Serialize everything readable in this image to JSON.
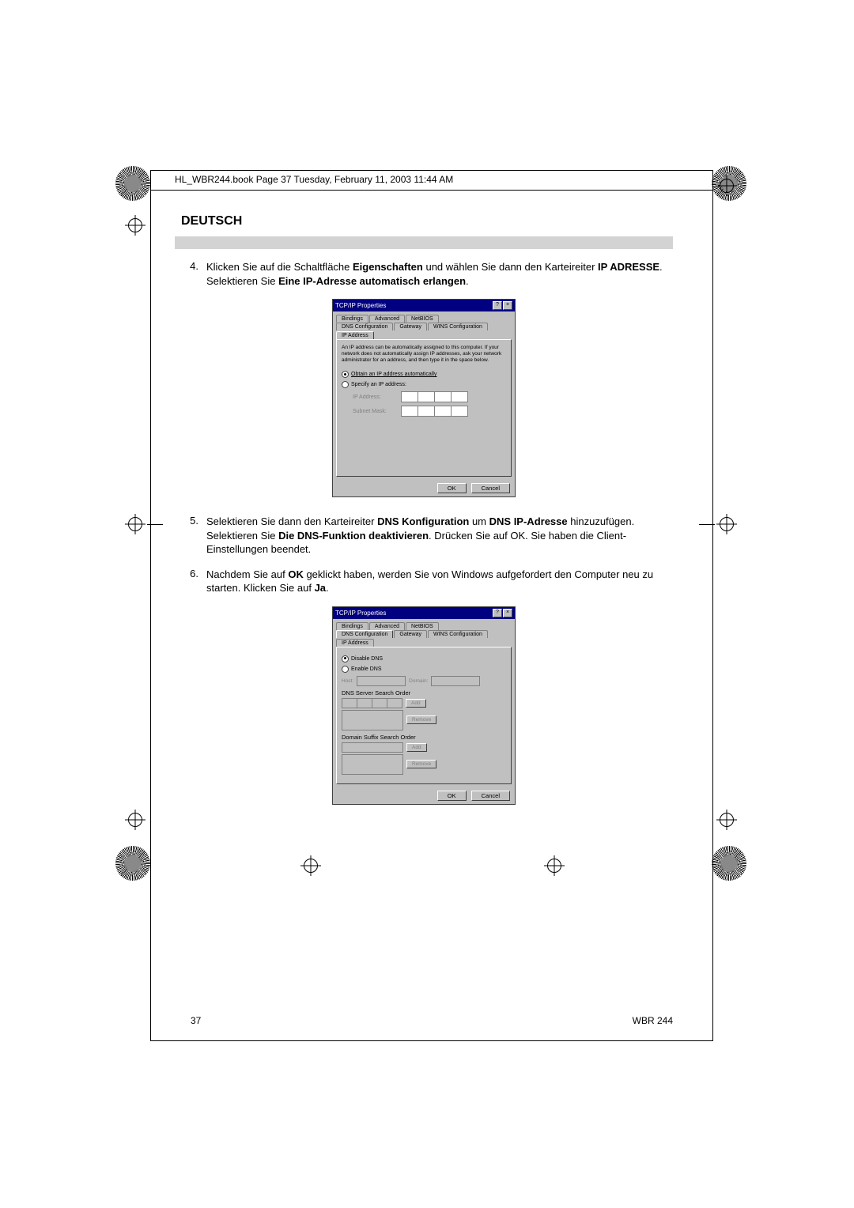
{
  "header_line": "HL_WBR244.book  Page 37  Tuesday, February 11, 2003  11:44 AM",
  "section_title": "DEUTSCH",
  "steps": {
    "s4": {
      "num": "4.",
      "pre": "Klicken Sie auf die Schaltfläche ",
      "b1": "Eigenschaften",
      "mid1": " und wählen Sie dann den Karteireiter ",
      "b2": "IP ADRESSE",
      "mid2": ". Selektieren Sie ",
      "b3": "Eine IP-Adresse automatisch erlangen",
      "post": "."
    },
    "s5": {
      "num": "5.",
      "pre": "Selektieren Sie dann den Karteireiter ",
      "b1": "DNS Konfiguration",
      "mid1": " um ",
      "b2": "DNS IP-Adresse",
      "mid2": " hinzuzufügen. Selektieren Sie ",
      "b3": "Die DNS-Funktion deaktivieren",
      "post": ". Drücken Sie auf OK. Sie haben die Client-Einstellungen beendet."
    },
    "s6": {
      "num": "6.",
      "pre": "Nachdem Sie auf ",
      "b1": "OK",
      "mid1": " geklickt haben, werden Sie von Windows aufgefordert den Computer neu zu starten. Klicken Sie auf ",
      "b2": "Ja",
      "post": "."
    }
  },
  "dialog1": {
    "title": "TCP/IP Properties",
    "tabs_row1": [
      "Bindings",
      "Advanced",
      "NetBIOS"
    ],
    "tabs_row2": [
      "DNS Configuration",
      "Gateway",
      "WINS Configuration",
      "IP Address"
    ],
    "active_tab": "IP Address",
    "desc": "An IP address can be automatically assigned to this computer. If your network does not automatically assign IP addresses, ask your network administrator for an address, and then type it in the space below.",
    "radio1": "Obtain an IP address automatically",
    "radio2": "Specify an IP address:",
    "ip_label": "IP Address:",
    "mask_label": "Subnet Mask:",
    "ok": "OK",
    "cancel": "Cancel"
  },
  "dialog2": {
    "title": "TCP/IP Properties",
    "tabs_row1": [
      "Bindings",
      "Advanced",
      "NetBIOS"
    ],
    "tabs_row2": [
      "DNS Configuration",
      "Gateway",
      "WINS Configuration",
      "IP Address"
    ],
    "active_tab": "DNS Configuration",
    "radio1": "Disable DNS",
    "radio2": "Enable DNS",
    "host_label": "Host:",
    "domain_label": "Domain:",
    "search_order": "DNS Server Search Order",
    "suffix_order": "Domain Suffix Search Order",
    "add": "Add",
    "remove": "Remove",
    "ok": "OK",
    "cancel": "Cancel"
  },
  "footer": {
    "page": "37",
    "model": "WBR 244"
  }
}
